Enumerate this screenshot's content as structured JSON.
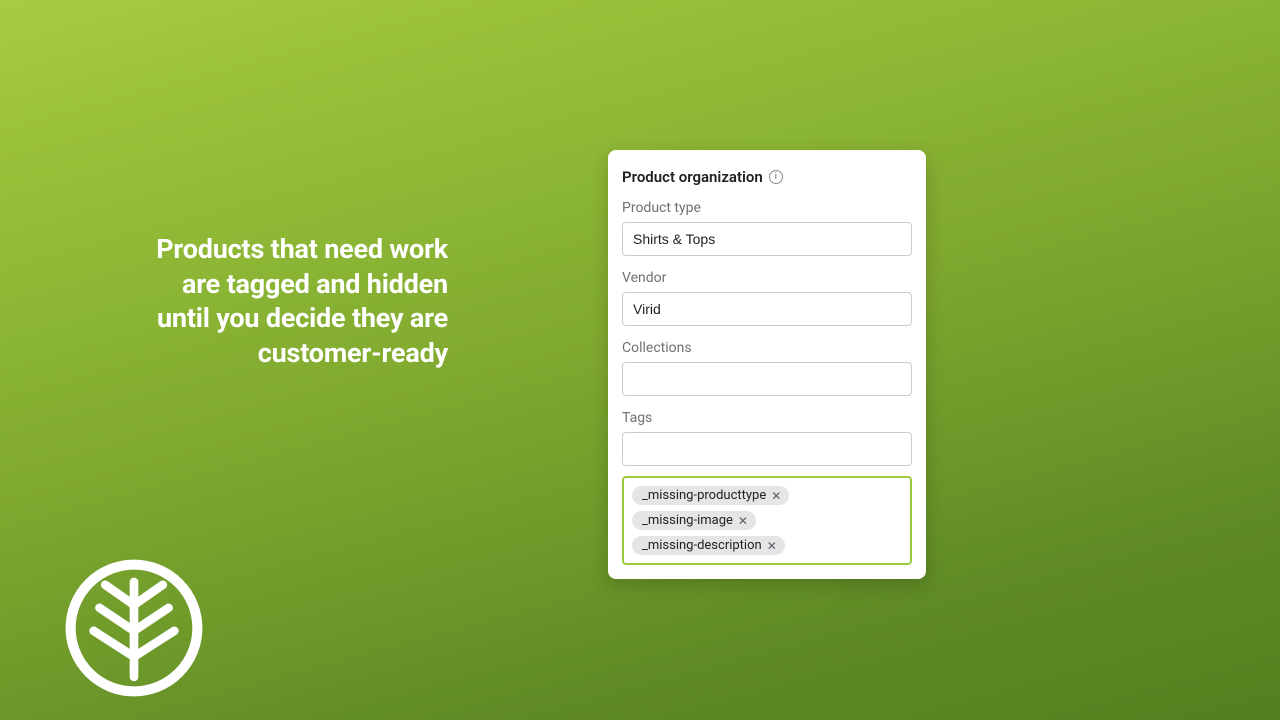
{
  "headline": "Products that need work are tagged and hidden until you decide they are customer-ready",
  "card": {
    "title": "Product organization",
    "fields": {
      "product_type": {
        "label": "Product type",
        "value": "Shirts & Tops"
      },
      "vendor": {
        "label": "Vendor",
        "value": "Virid"
      },
      "collections": {
        "label": "Collections",
        "value": ""
      },
      "tags": {
        "label": "Tags",
        "value": ""
      }
    },
    "applied_tags": [
      "_missing-producttype",
      "_missing-image",
      "_missing-description"
    ]
  },
  "colors": {
    "highlight_border": "#9ccc3c"
  }
}
